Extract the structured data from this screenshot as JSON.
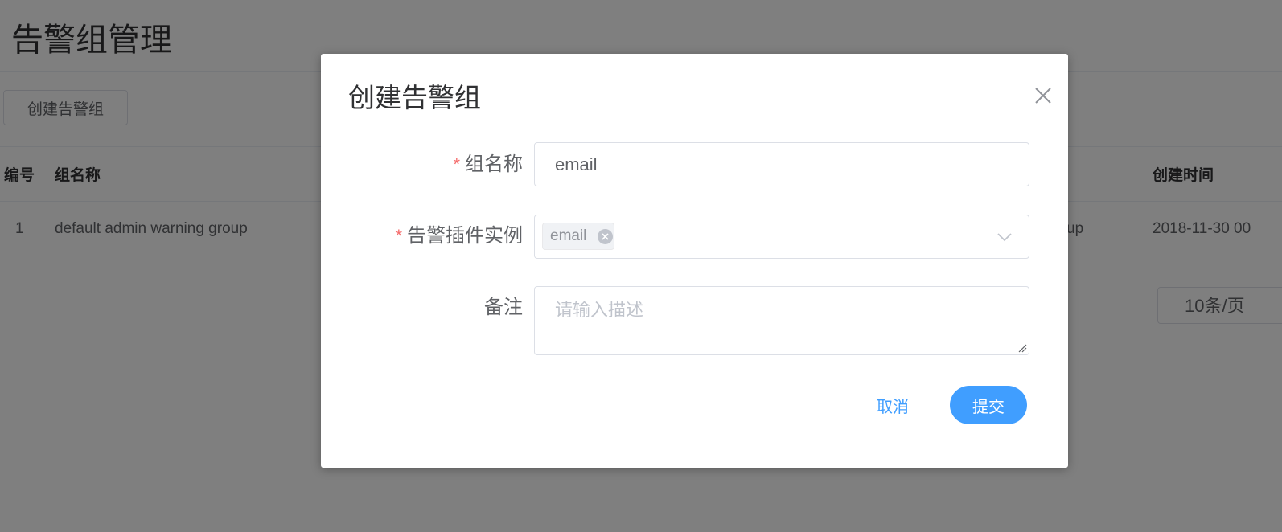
{
  "page": {
    "title": "告警组管理",
    "create_button": "创建告警组",
    "table": {
      "columns": [
        "编号",
        "组名称",
        "创建时间"
      ],
      "rows": [
        {
          "id": "1",
          "name": "default admin warning group",
          "description_fragment": "up",
          "created": "2018-11-30 00"
        }
      ]
    },
    "page_size": "10条/页"
  },
  "dialog": {
    "title": "创建告警组",
    "fields": {
      "group_name": {
        "required_mark": "*",
        "label": "组名称",
        "value": "email"
      },
      "alert_plugins": {
        "required_mark": "*",
        "label": "告警插件实例",
        "selected_tags": [
          "email"
        ]
      },
      "remark": {
        "label": "备注",
        "value": "",
        "placeholder": "请输入描述"
      }
    },
    "cancel_label": "取消",
    "submit_label": "提交"
  },
  "colors": {
    "primary": "#409eff",
    "required": "#f56c6c",
    "overlay": "rgba(0,0,0,0.5)",
    "border": "#dcdfe6"
  },
  "icons": {
    "close": "close-icon",
    "dropdown": "chevron-down-icon",
    "tag_remove": "tag-close-icon",
    "resize": "resize-handle-icon"
  }
}
